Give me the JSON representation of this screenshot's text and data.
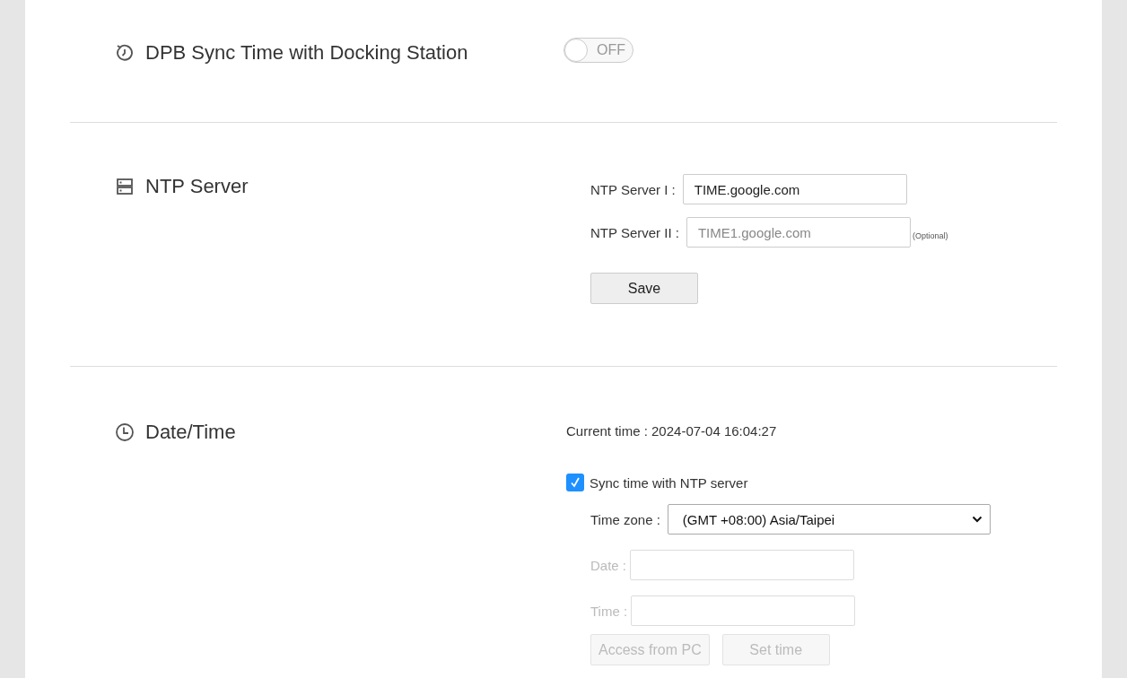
{
  "toggle_section": {
    "title": "DPB Sync Time with Docking Station",
    "toggle": {
      "on": false,
      "label": "OFF"
    }
  },
  "ntp_section": {
    "title": "NTP Server",
    "fields": [
      {
        "label": "NTP Server I :",
        "value": "TIME.google.com"
      },
      {
        "label": "NTP Server II :",
        "placeholder": "TIME1.google.com",
        "note": "(Optional)"
      }
    ],
    "save_button": "Save"
  },
  "datetime_section": {
    "title": "Date/Time",
    "current_time": "Current time : 2024-07-04 16:04:27",
    "sync_checkbox": {
      "label": "Sync time with NTP server",
      "checked": true
    },
    "timezone": {
      "label": "Time zone :",
      "value": "(GMT +08:00) Asia/Taipei"
    },
    "manual_fields": [
      {
        "label": "Date :",
        "disabled": true
      },
      {
        "label": "Time :",
        "disabled": true
      }
    ],
    "buttons": [
      {
        "label": "Access from PC",
        "disabled": true
      },
      {
        "label": "Set time",
        "disabled": true
      }
    ]
  }
}
